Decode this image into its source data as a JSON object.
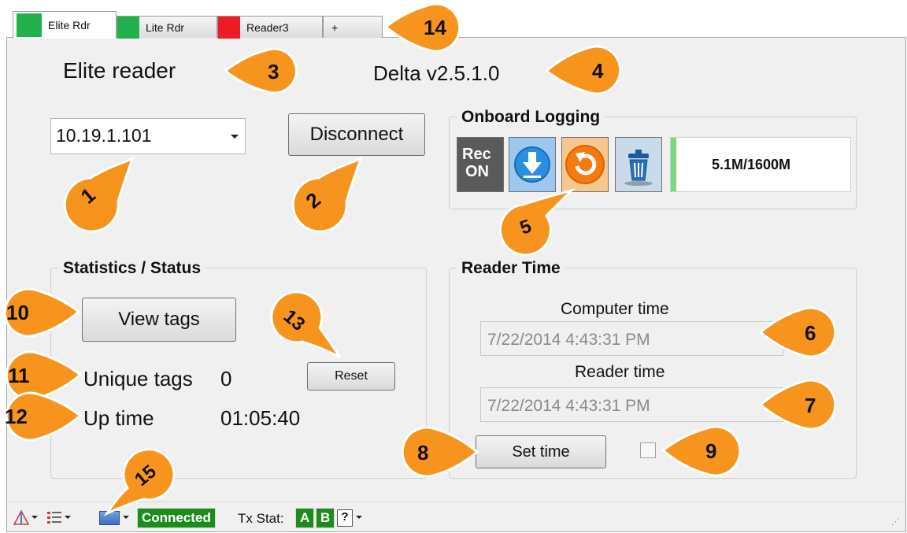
{
  "tabs": [
    {
      "label": "Elite Rdr",
      "color": "#22b14c",
      "active": true
    },
    {
      "label": "Lite Rdr",
      "color": "#22b14c",
      "active": false
    },
    {
      "label": "Reader3",
      "color": "#ed1c24",
      "active": false
    },
    {
      "label": "+",
      "active": false
    }
  ],
  "header": {
    "reader_name": "Elite reader",
    "version": "Delta v2.5.1.0"
  },
  "connection": {
    "ip_value": "10.19.1.101",
    "disconnect_label": "Disconnect"
  },
  "logging": {
    "title": "Onboard Logging",
    "rec_label_1": "Rec",
    "rec_label_2": "ON",
    "storage_text": "5.1M/1600M",
    "storage_fill": 0.03
  },
  "stats": {
    "title": "Statistics / Status",
    "view_tags_label": "View tags",
    "reset_label": "Reset",
    "unique_tags_label": "Unique tags",
    "unique_tags_value": "0",
    "uptime_label": "Up time",
    "uptime_value": "01:05:40"
  },
  "reader_time": {
    "title": "Reader Time",
    "computer_time_label": "Computer time",
    "computer_time_value": "7/22/2014 4:43:31 PM",
    "reader_time_label": "Reader time",
    "reader_time_value": "7/22/2014 4:43:31 PM",
    "set_time_label": "Set time"
  },
  "callouts": [
    "1",
    "2",
    "3",
    "4",
    "5",
    "6",
    "7",
    "8",
    "9",
    "10",
    "11",
    "12",
    "13",
    "14",
    "15"
  ],
  "statusbar": {
    "connected_label": "Connected",
    "tx_stat_label": "Tx Stat:",
    "a_label": "A",
    "b_label": "B",
    "help_label": "?"
  },
  "colors": {
    "callout": "#f7941d",
    "connected_bg": "#1e8b1e",
    "log_fill": "#7ed87e"
  }
}
